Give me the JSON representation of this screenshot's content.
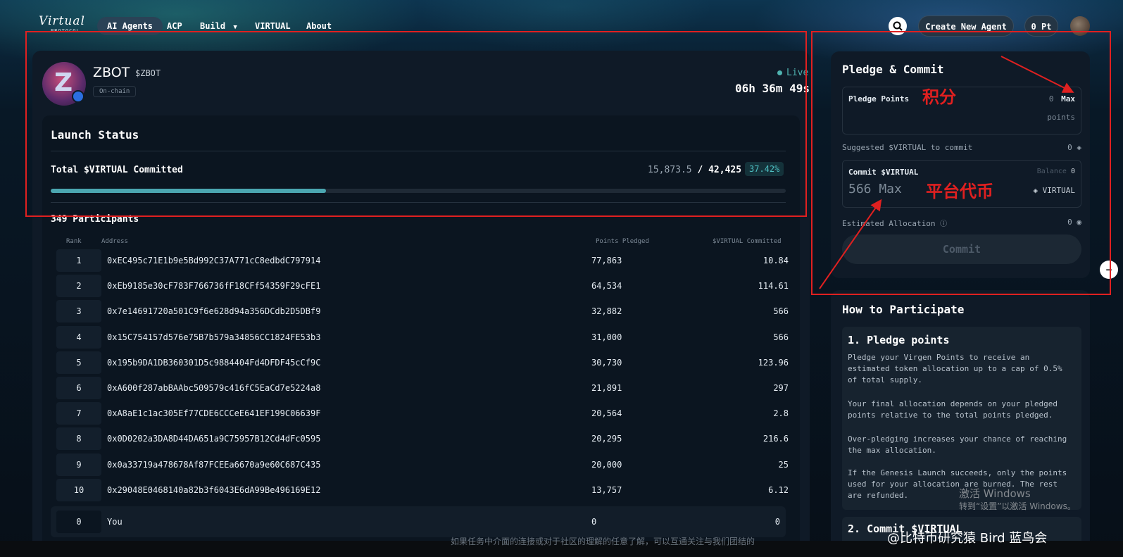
{
  "nav": {
    "logo": "Virtual",
    "logo_sub": "PROTOCOL",
    "items": [
      "AI Agents",
      "ACP",
      "Build",
      "VIRTUAL",
      "About"
    ],
    "create_label": "Create New Agent",
    "points_label": "0 Pt"
  },
  "agent": {
    "name": "ZBOT",
    "ticker": "$ZBOT",
    "tag": "On-chain",
    "status": "Live",
    "countdown": "06h 36m 49s"
  },
  "launch": {
    "title": "Launch Status",
    "committed_label": "Total $VIRTUAL Committed",
    "committed": "15,873.5",
    "target": "42,425",
    "percent_text": "37.42%",
    "progress_fraction": 0.3742,
    "participants": "349 Participants"
  },
  "table": {
    "headers": [
      "Rank",
      "Address",
      "Points Pledged",
      "$VIRTUAL Committed"
    ],
    "rows": [
      {
        "rank": "1",
        "address": "0xEC495c71E1b9e5Bd992C37A771cC8edbdC797914",
        "points": "77,863",
        "virtual": "10.84"
      },
      {
        "rank": "2",
        "address": "0xEb9185e30cF783F766736fF18CFf54359F29cFE1",
        "points": "64,534",
        "virtual": "114.61"
      },
      {
        "rank": "3",
        "address": "0x7e14691720a501C9f6e628d94a356DCdb2D5DBf9",
        "points": "32,882",
        "virtual": "566"
      },
      {
        "rank": "4",
        "address": "0x15C754157d576e75B7b579a34856CC1824FE53b3",
        "points": "31,000",
        "virtual": "566"
      },
      {
        "rank": "5",
        "address": "0x195b9DA1DB360301D5c9884404Fd4DFDF45cCf9C",
        "points": "30,730",
        "virtual": "123.96"
      },
      {
        "rank": "6",
        "address": "0xA600f287abBAAbc509579c416fC5EaCd7e5224a8",
        "points": "21,891",
        "virtual": "297"
      },
      {
        "rank": "7",
        "address": "0xA8aE1c1ac305Ef77CDE6CCCeE641EF199C06639F",
        "points": "20,564",
        "virtual": "2.8"
      },
      {
        "rank": "8",
        "address": "0x0D0202a3DA8D44DA651a9C75957B12Cd4dFc0595",
        "points": "20,295",
        "virtual": "216.6"
      },
      {
        "rank": "9",
        "address": "0x0a33719a478678Af87FCEEa6670a9e60C687C435",
        "points": "20,000",
        "virtual": "25"
      },
      {
        "rank": "10",
        "address": "0x29048E0468140a82b3f6043E6dA99Be496169E12",
        "points": "13,757",
        "virtual": "6.12"
      }
    ],
    "you": {
      "rank": "0",
      "address": "You",
      "points": "0",
      "virtual": "0"
    }
  },
  "pledge": {
    "title": "Pledge & Commit",
    "points_label": "Pledge Points",
    "points_value": "0",
    "max_label": "Max",
    "points_unit": "points",
    "suggest_label": "Suggested $VIRTUAL to commit",
    "suggest_value": "0",
    "commit_label": "Commit $VIRTUAL",
    "balance_label": "Balance",
    "balance_value": "0",
    "commit_input": "566 Max",
    "virtual_tag": "VIRTUAL",
    "estimate_label": "Estimated Allocation",
    "estimate_value": "0",
    "commit_button": "Commit"
  },
  "how": {
    "title": "How to Participate",
    "step1_title": "1. Pledge points",
    "step1_p1": "Pledge your Virgen Points to receive an estimated token allocation up to a cap of 0.5% of total supply.",
    "step1_p2": "Your final allocation depends on your pledged points relative to the total points pledged.",
    "step1_p3": "Over-pledging increases your chance of reaching the max allocation.",
    "step1_p4": "If the Genesis Launch succeeds, only the points used for your allocation are burned. The rest are refunded.",
    "step2_title": "2. Commit $VIRTUAL"
  },
  "annotations": {
    "points_cn": "积分",
    "token_cn": "平台代币"
  },
  "overlay": {
    "windows_1": "激活 Windows",
    "windows_2": "转到“设置”以激活 Windows。",
    "watermark": "@比特币研究猿 Bird 蓝鸟会",
    "bottom_text": "如果任务中介面的连接或对于社区的理解的任意了解，可以互通关注与我们团结的"
  },
  "colors": {
    "accent": "#4fc0c4",
    "annotation": "#e02020",
    "panel": "#0f1a27"
  }
}
